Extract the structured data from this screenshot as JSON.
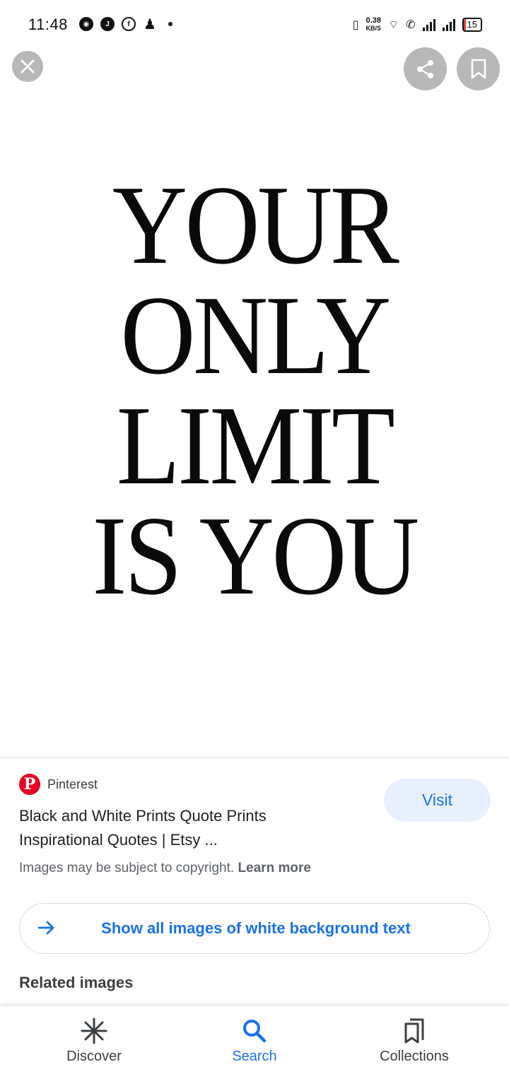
{
  "status_bar": {
    "time": "11:48",
    "app_icons": [
      "discord-icon",
      "jio-icon",
      "facebook-icon",
      "snapchat-icon"
    ],
    "net_speed_value": "0.38",
    "net_speed_unit": "KB/S",
    "battery": "15",
    "battery_color": "#e53935"
  },
  "top_actions": {
    "close_icon": "close-icon",
    "share_icon": "share-icon",
    "save_icon": "bookmark-icon"
  },
  "image": {
    "quote_lines": [
      "YOUR",
      "ONLY",
      "LIMIT",
      "IS YOU"
    ]
  },
  "result": {
    "source": "Pinterest",
    "source_color": "#e60023",
    "title": "Black and White Prints Quote Prints Inspirational Quotes | Etsy ...",
    "visit_label": "Visit",
    "copyright_text": "Images may be subject to copyright.",
    "learn_more": "Learn more"
  },
  "show_all": {
    "label": "Show all images of white background text"
  },
  "related_heading": "Related images",
  "bottom_nav": [
    {
      "label": "Discover",
      "icon": "discover-icon",
      "active": false
    },
    {
      "label": "Search",
      "icon": "search-icon",
      "active": true
    },
    {
      "label": "Collections",
      "icon": "collections-icon",
      "active": false
    }
  ],
  "colors": {
    "accent": "#1a73e8",
    "visit_bg": "#e8f0fe",
    "overlay_button": "#b8b8b8"
  }
}
